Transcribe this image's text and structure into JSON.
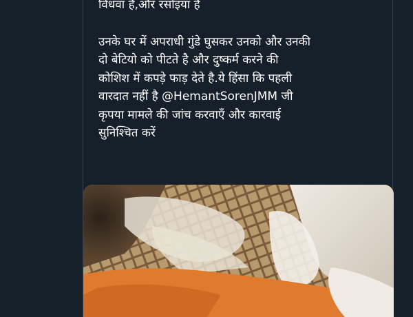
{
  "tweet": {
    "lines_first": [
      "विधवा है,और रसोइया है"
    ],
    "lines_second": [
      "उनके घर में अपराधी गुंडे घुसकर उनको और उनकी",
      "दो बेटियो को पीटते है और दुष्कर्म करने की",
      "कोशिश में कपड़े फाड़ देते है.ये हिंसा कि पहली",
      "वारदात नहीं है "
    ],
    "mention": "@HemantSorenJMM",
    "after_mention": "  जी",
    "lines_third": [
      "कृपया मामले की जांच करवाएँ और कारवाई",
      "सुनिश्चित करें"
    ]
  },
  "colors": {
    "background": "#15202b",
    "text": "#ffffff",
    "border": "#38444d",
    "saree": "#e07a2e"
  }
}
